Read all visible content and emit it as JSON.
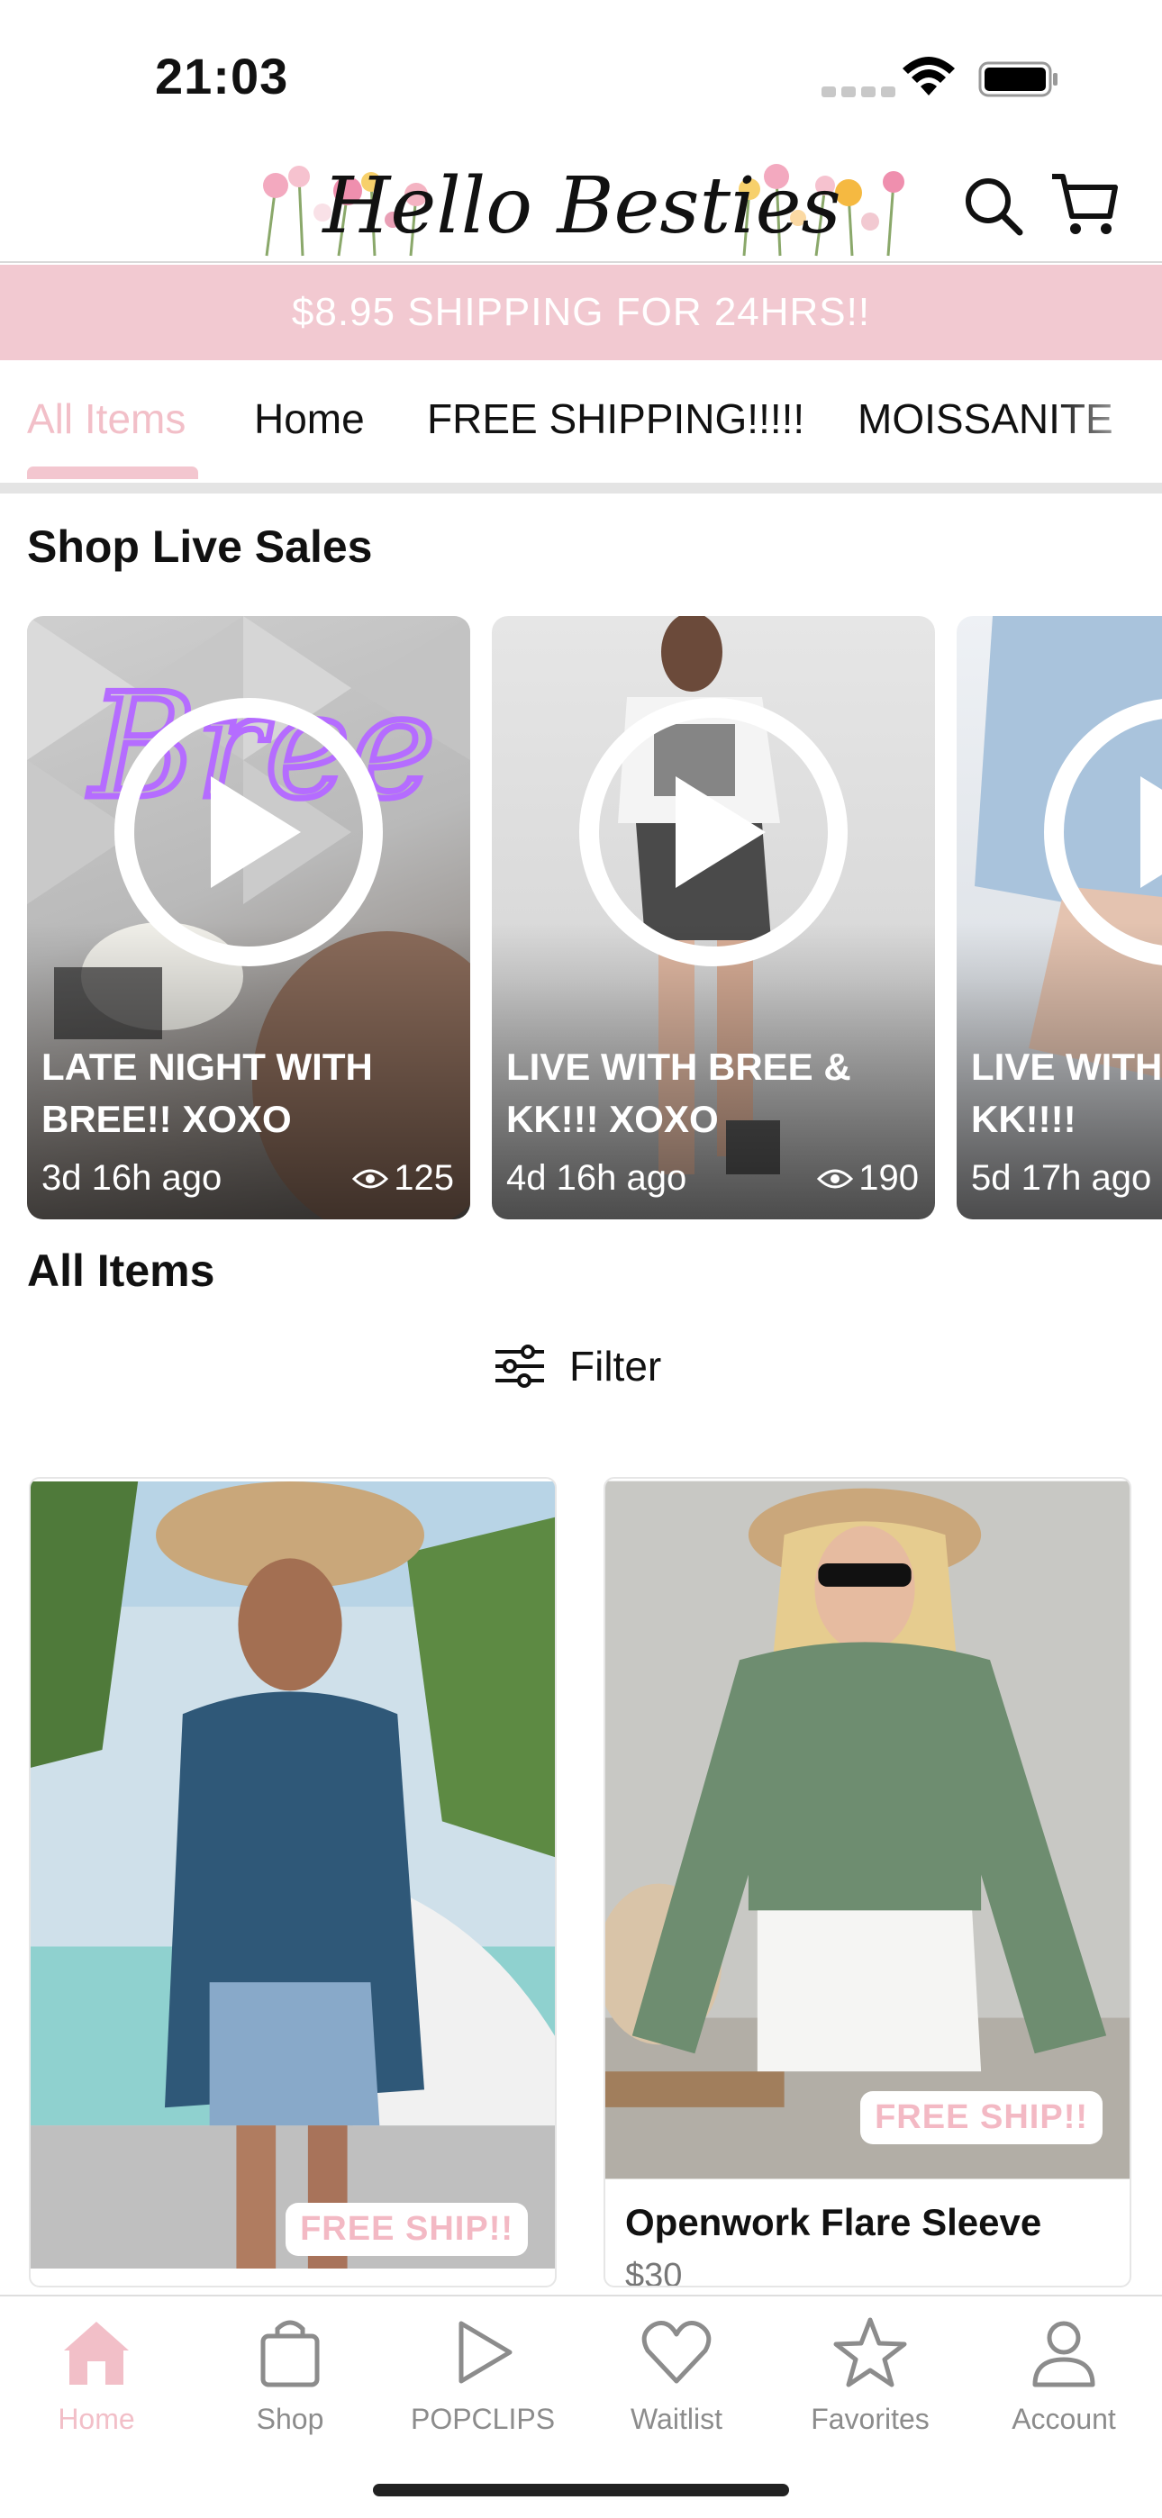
{
  "status_bar": {
    "time": "21:03"
  },
  "header": {
    "logo_text": "Hello Besties"
  },
  "promo": {
    "text": "$8.95 SHIPPING FOR 24HRS!!"
  },
  "tabs": [
    {
      "label": "All Items",
      "active": true
    },
    {
      "label": "Home",
      "active": false
    },
    {
      "label": "FREE SHIPPING!!!!!",
      "active": false
    },
    {
      "label": "MOISSANITE",
      "active": false
    }
  ],
  "live_section": {
    "title": "Shop Live Sales"
  },
  "live_cards": [
    {
      "title": "LATE NIGHT WITH BREE!! XOXO",
      "time": "3d 16h ago",
      "views": "125"
    },
    {
      "title": "LIVE WITH BREE & KK!!! XOXO",
      "time": "4d 16h ago",
      "views": "190"
    },
    {
      "title": "LIVE WITH BREE & KK!!!!",
      "time": "5d 17h ago",
      "views": ""
    }
  ],
  "all_items": {
    "title": "All Items",
    "filter_label": "Filter"
  },
  "products": [
    {
      "name": "",
      "price": "",
      "badge": "FREE SHIP!!"
    },
    {
      "name": "Openwork Flare Sleeve",
      "price": "$30",
      "badge": "FREE SHIP!!"
    }
  ],
  "bottom_nav": [
    {
      "label": "Home",
      "icon": "home-icon",
      "active": true
    },
    {
      "label": "Shop",
      "icon": "shopping-bag-icon",
      "active": false
    },
    {
      "label": "POPCLIPS",
      "icon": "play-icon",
      "active": false
    },
    {
      "label": "Waitlist",
      "icon": "heart-icon",
      "active": false
    },
    {
      "label": "Favorites",
      "icon": "star-icon",
      "active": false
    },
    {
      "label": "Account",
      "icon": "person-icon",
      "active": false
    }
  ],
  "colors": {
    "accent_pink": "#f2bfc8",
    "banner_pink": "#f2c9d1"
  }
}
